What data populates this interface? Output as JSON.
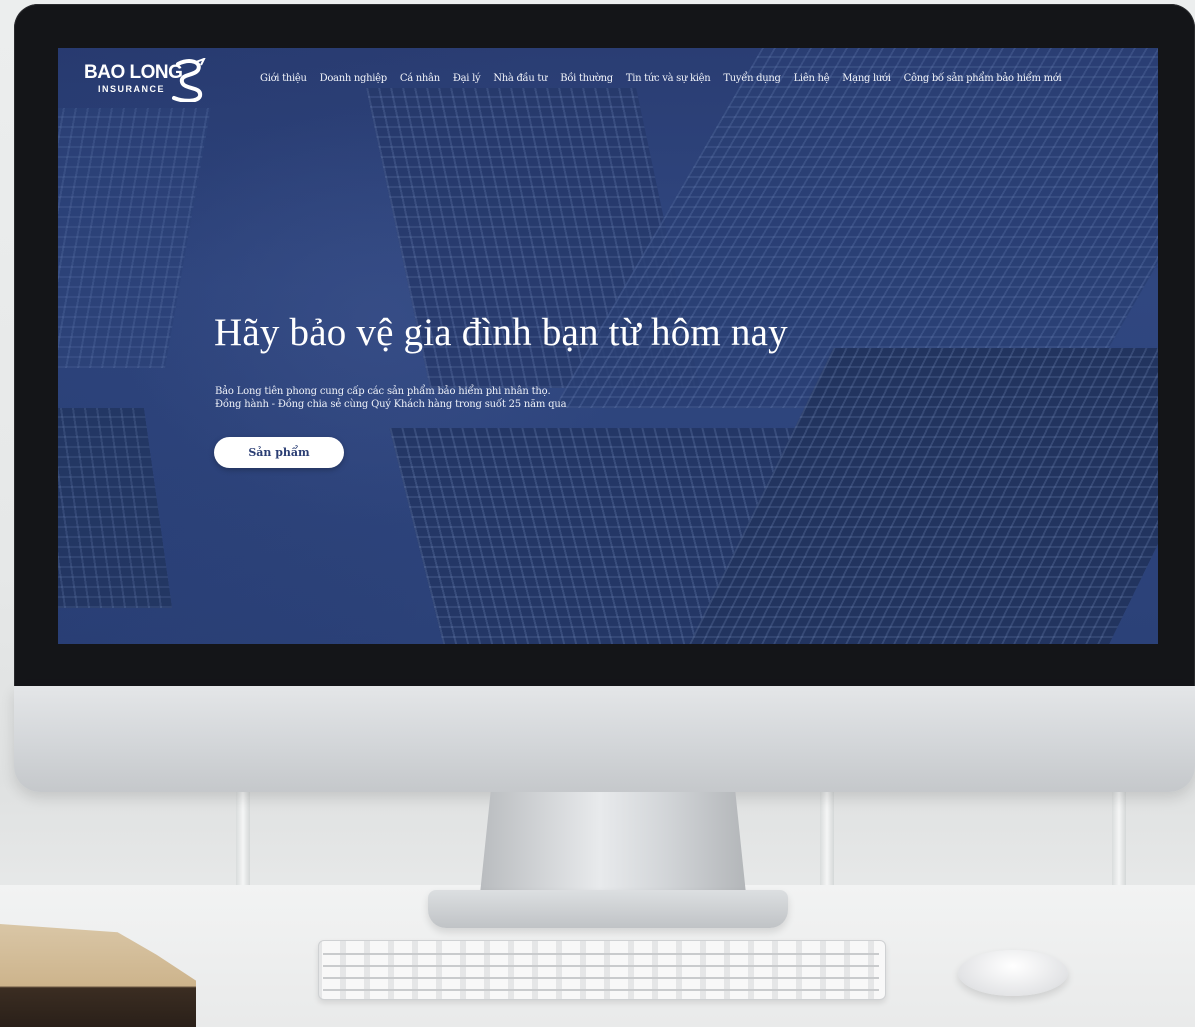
{
  "logo": {
    "main": "BAO LONG",
    "sub": "INSURANCE"
  },
  "nav": {
    "items": [
      "Giới thiệu",
      "Doanh nghiệp",
      "Cá nhân",
      "Đại lý",
      "Nhà đầu tư",
      "Bồi thường",
      "Tin tức và sự kiện",
      "Tuyển dụng",
      "Liên hệ",
      "Mạng lưới",
      "Công bố sản phẩm bảo hiểm mới"
    ]
  },
  "hero": {
    "title": "Hãy bảo vệ gia đình bạn từ hôm nay",
    "line1": "Bảo Long tiên phong cung cấp các sản phẩm bảo hiểm phi nhân thọ.",
    "line2": "Đồng hành - Đồng chia sẻ cùng Quý Khách hàng trong suốt 25 năm qua",
    "cta_label": "Sản phẩm"
  }
}
